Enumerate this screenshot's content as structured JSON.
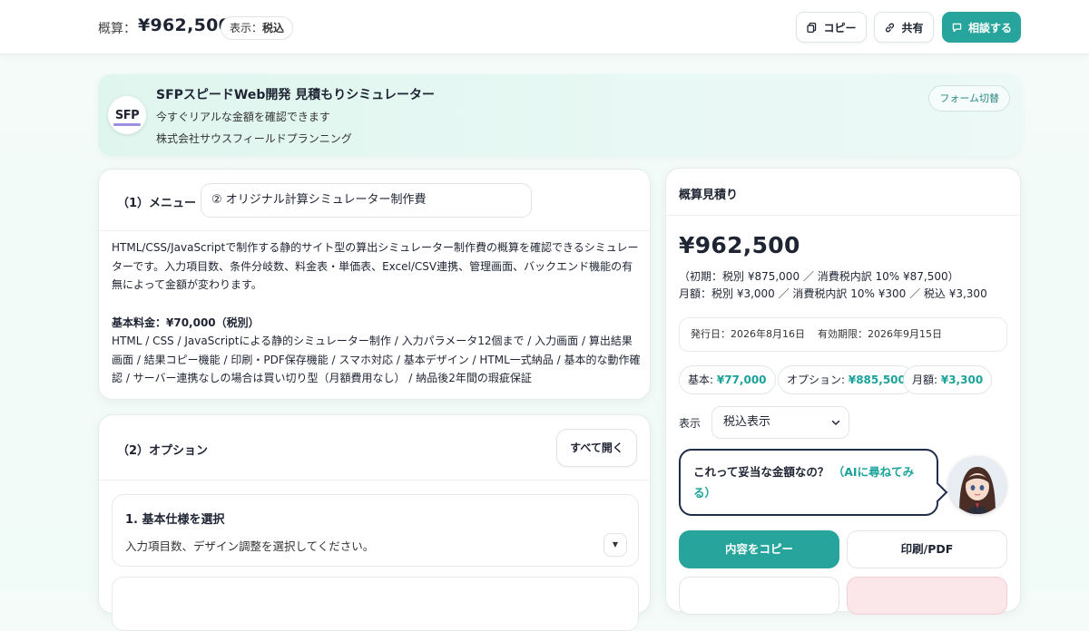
{
  "topbar": {
    "estimate_label": "概算：",
    "estimate_value": "¥962,500",
    "display_prefix": "表示：",
    "display_value": "税込",
    "copy_label": "コピー",
    "share_label": "共有",
    "consult_label": "相談する"
  },
  "header": {
    "logo_text": "SFP",
    "title": "SFPスピードWeb開発 見積もりシミュレーター",
    "subtitle": "今すぐリアルな金額を確認できます",
    "company": "株式会社サウスフィールドプランニング",
    "form_switch_label": "フォーム切替"
  },
  "menu": {
    "section_label": "（1）メニュー",
    "selected_value": "② オリジナル計算シミュレーター制作費",
    "description": "HTML/CSS/JavaScriptで制作する静的サイト型の算出シミュレーター制作費の概算を確認できるシミュレーターです。入力項目数、条件分岐数、料金表・単価表、Excel/CSV連携、管理画面、バックエンド機能の有無によって金額が変わります。",
    "base_price_label": "基本料金：¥70,000（税別）",
    "base_price_details": "HTML / CSS / JavaScriptによる静的シミュレーター制作 / 入力パラメータ12個まで / 入力画面 / 算出結果画面 / 結果コピー機能 / 印刷・PDF保存機能 / スマホ対応 / 基本デザイン / HTML一式納品 / 基本的な動作確認 / サーバー連携なしの場合は買い切り型（月額費用なし） / 納品後2年間の瑕疵保証"
  },
  "options": {
    "section_label": "（2）オプション",
    "open_all_label": "すべて開く",
    "items": [
      {
        "title": "1. 基本仕様を選択",
        "description": "入力項目数、デザイン調整を選択してください。"
      }
    ]
  },
  "estimate": {
    "title": "概算見積り",
    "total": "¥962,500",
    "initial_line": "（初期：税別 ¥875,000 ／ 消費税内訳 10% ¥87,500）",
    "monthly_line": "月額：税別 ¥3,000 ／ 消費税内訳 10% ¥300 ／ 税込 ¥3,300",
    "issue_date": "発行日：2026年8月16日",
    "valid_until": "有効期限：2026年9月15日",
    "chips": [
      {
        "label": "基本: ",
        "value": "¥77,000"
      },
      {
        "label": "オプション: ",
        "value": "¥885,500"
      },
      {
        "label": "月額: ",
        "value": "¥3,300"
      }
    ],
    "display_label": "表示",
    "display_select": "税込表示",
    "bubble_text": "これって妥当な金額なの？",
    "bubble_ai": "（AIに尋ねてみる）",
    "copy_button": "内容をコピー",
    "print_button": "印刷/PDF"
  },
  "colors": {
    "accent": "#27a59c",
    "accent_text": "#1aa39a",
    "navy": "#1f2d4a"
  }
}
